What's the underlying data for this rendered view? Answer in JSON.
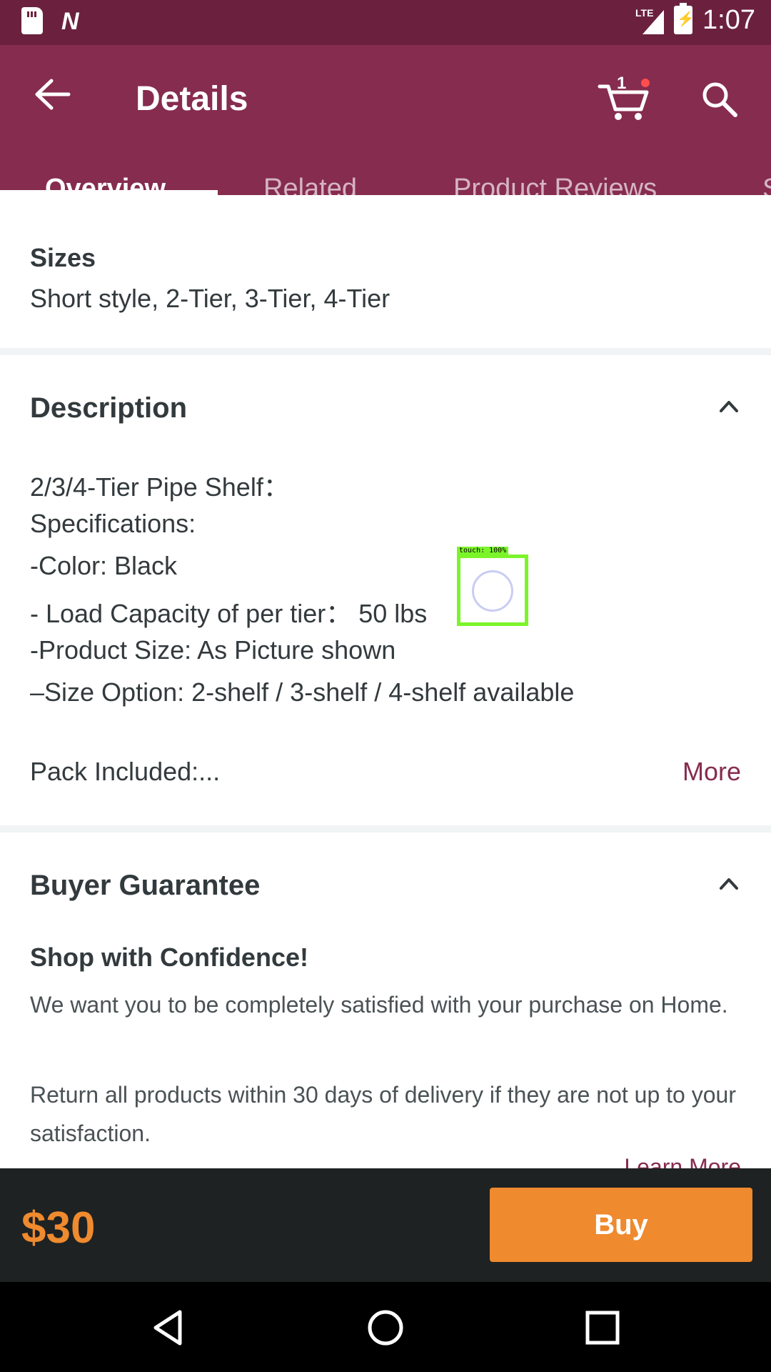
{
  "status_bar": {
    "time": "1:07",
    "network": "LTE"
  },
  "app_bar": {
    "title": "Details",
    "cart_count": "1"
  },
  "tabs": [
    {
      "label": "Overview"
    },
    {
      "label": "Related"
    },
    {
      "label": "Product Reviews"
    },
    {
      "label": "S"
    }
  ],
  "sizes": {
    "label": "Sizes",
    "value": "Short style, 2-Tier, 3-Tier, 4-Tier"
  },
  "description": {
    "title": "Description",
    "lines": [
      "2/3/4-Tier Pipe Shelf：",
      "Specifications:",
      "-Color: Black",
      "- Load Capacity of per tier：  50 lbs",
      "-Product Size: As Picture shown",
      "–Size Option: 2-shelf / 3-shelf / 4-shelf  available"
    ],
    "pack_included": "Pack Included:...",
    "more_label": "More"
  },
  "buyer_guarantee": {
    "title": "Buyer Guarantee",
    "subtitle": "Shop with Confidence!",
    "paragraph1": "We want you to be completely satisfied with your purchase on Home.",
    "paragraph2": "Return all products within 30 days of delivery if they are not up to your satisfaction.",
    "learn_more": "Learn More"
  },
  "touch_overlay": {
    "label": "touch: 100%"
  },
  "buy_bar": {
    "price": "$30",
    "buy_label": "Buy"
  },
  "colors": {
    "brand": "#862c4f",
    "status_bar": "#6b213e",
    "accent": "#ef8a2e",
    "buy_bar_bg": "#1e2223"
  }
}
